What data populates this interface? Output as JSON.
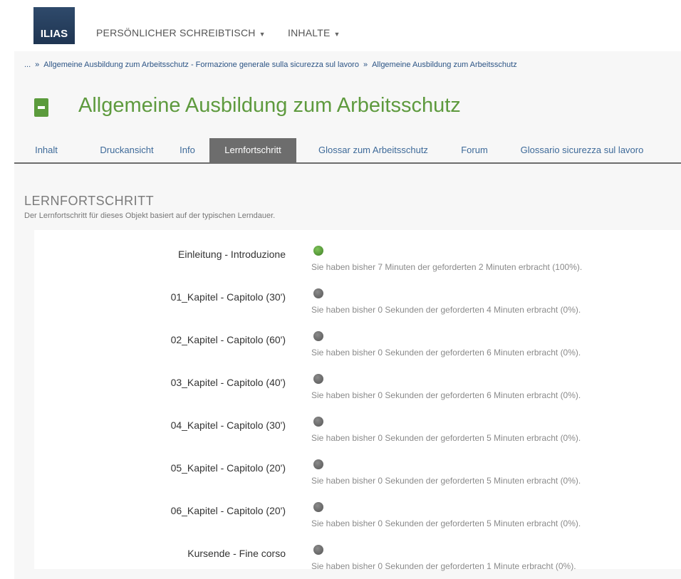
{
  "app": {
    "logo_text": "ILIAS",
    "menu": [
      {
        "label": "PERSÖNLICHER SCHREIBTISCH"
      },
      {
        "label": "INHALTE"
      }
    ]
  },
  "breadcrumb": {
    "ellipsis": "...",
    "items": [
      "Allgemeine Ausbildung zum Arbeitsschutz - Formazione generale sulla sicurezza sul lavoro",
      "Allgemeine Ausbildung zum Arbeitsschutz"
    ],
    "separator": "»"
  },
  "page": {
    "title": "Allgemeine Ausbildung zum Arbeitsschutz",
    "icon": "learning-module-icon",
    "accent_color": "#5e9a3e"
  },
  "tabs": [
    {
      "label": "Inhalt",
      "active": false
    },
    {
      "label": "Druckansicht",
      "active": false
    },
    {
      "label": "Info",
      "active": false
    },
    {
      "label": "Lernfortschritt",
      "active": true
    },
    {
      "label": "Glossar zum Arbeitsschutz",
      "active": false
    },
    {
      "label": "Forum",
      "active": false
    },
    {
      "label": "Glossario sicurezza sul lavoro",
      "active": false
    }
  ],
  "progress": {
    "title": "LERNFORTSCHRITT",
    "description": "Der Lernfortschritt für dieses Objekt basiert auf der typischen Lerndauer.",
    "rows": [
      {
        "label": "Einleitung - Introduzione",
        "status": "completed",
        "info": "Sie haben bisher 7 Minuten der geforderten 2 Minuten erbracht (100%)."
      },
      {
        "label": "01_Kapitel - Capitolo (30')",
        "status": "not-attempted",
        "info": "Sie haben bisher 0 Sekunden der geforderten 4 Minuten erbracht (0%)."
      },
      {
        "label": "02_Kapitel - Capitolo (60')",
        "status": "not-attempted",
        "info": "Sie haben bisher 0 Sekunden der geforderten 6 Minuten erbracht (0%)."
      },
      {
        "label": "03_Kapitel - Capitolo (40')",
        "status": "not-attempted",
        "info": "Sie haben bisher 0 Sekunden der geforderten 6 Minuten erbracht (0%)."
      },
      {
        "label": "04_Kapitel - Capitolo (30')",
        "status": "not-attempted",
        "info": "Sie haben bisher 0 Sekunden der geforderten 5 Minuten erbracht (0%)."
      },
      {
        "label": "05_Kapitel - Capitolo (20')",
        "status": "not-attempted",
        "info": "Sie haben bisher 0 Sekunden der geforderten 5 Minuten erbracht (0%)."
      },
      {
        "label": "06_Kapitel - Capitolo (20')",
        "status": "not-attempted",
        "info": "Sie haben bisher 0 Sekunden der geforderten 5 Minuten erbracht (0%)."
      },
      {
        "label": "Kursende - Fine corso",
        "status": "not-attempted",
        "info": "Sie haben bisher 0 Sekunden der geforderten 1 Minute erbracht (0%)."
      }
    ]
  }
}
